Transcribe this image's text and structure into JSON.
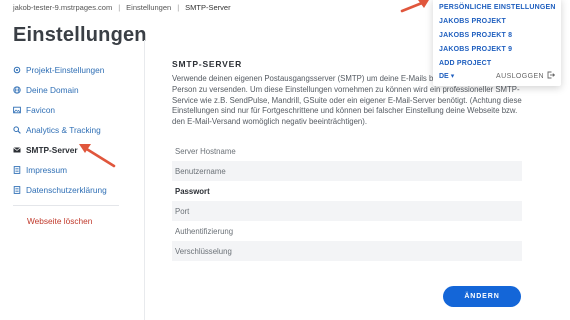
{
  "breadcrumb": {
    "site": "jakob-tester-9.mstrpages.com",
    "section": "Einstellungen",
    "current": "SMTP-Server"
  },
  "page_title": "Einstellungen",
  "sidebar": {
    "items": [
      {
        "label": "Projekt-Einstellungen",
        "icon": "gear-icon"
      },
      {
        "label": "Deine Domain",
        "icon": "globe-icon"
      },
      {
        "label": "Favicon",
        "icon": "image-icon"
      },
      {
        "label": "Analytics & Tracking",
        "icon": "search-icon"
      },
      {
        "label": "SMTP-Server",
        "icon": "mail-icon",
        "active": true
      },
      {
        "label": "Impressum",
        "icon": "document-icon"
      },
      {
        "label": "Datenschutzerklärung",
        "icon": "document-icon"
      }
    ],
    "delete_label": "Webseite löschen"
  },
  "main": {
    "section_title": "SMTP-SERVER",
    "description": "Verwende deinen eigenen Postausgangsserver (SMTP) um deine E-Mails bzw. direkt von deiner Person zu versenden. Um diese Einstellungen vornehmen zu können wird ein professioneller SMTP-Service wie z.B. SendPulse, Mandrill, GSuite oder ein eigener E-Mail-Server benötigt. (Achtung diese Einstellungen sind nur für Fortgeschrittene und können bei falscher Einstellung deine Webseite bzw. den E-Mail-Versand womöglich negativ beeinträchtigen).",
    "fields": {
      "hostname": "Server Hostname",
      "username": "Benutzername",
      "password": "Passwort",
      "port": "Port",
      "auth": "Authentifizierung",
      "encryption": "Verschlüsselung"
    },
    "save_label": "ÄNDERN"
  },
  "dropdown": {
    "items": [
      "PERSÖNLICHE EINSTELLUNGEN",
      "JAKOBS PROJEKT",
      "JAKOBS PROJEKT 8",
      "JAKOBS PROJEKT 9",
      "ADD PROJECT"
    ],
    "language": "DE",
    "logout": "AUSLOGGEN"
  },
  "colors": {
    "accent": "#1466d8",
    "link": "#2f6fb5",
    "danger": "#c0392b",
    "annotation_arrow": "#e0563c"
  }
}
